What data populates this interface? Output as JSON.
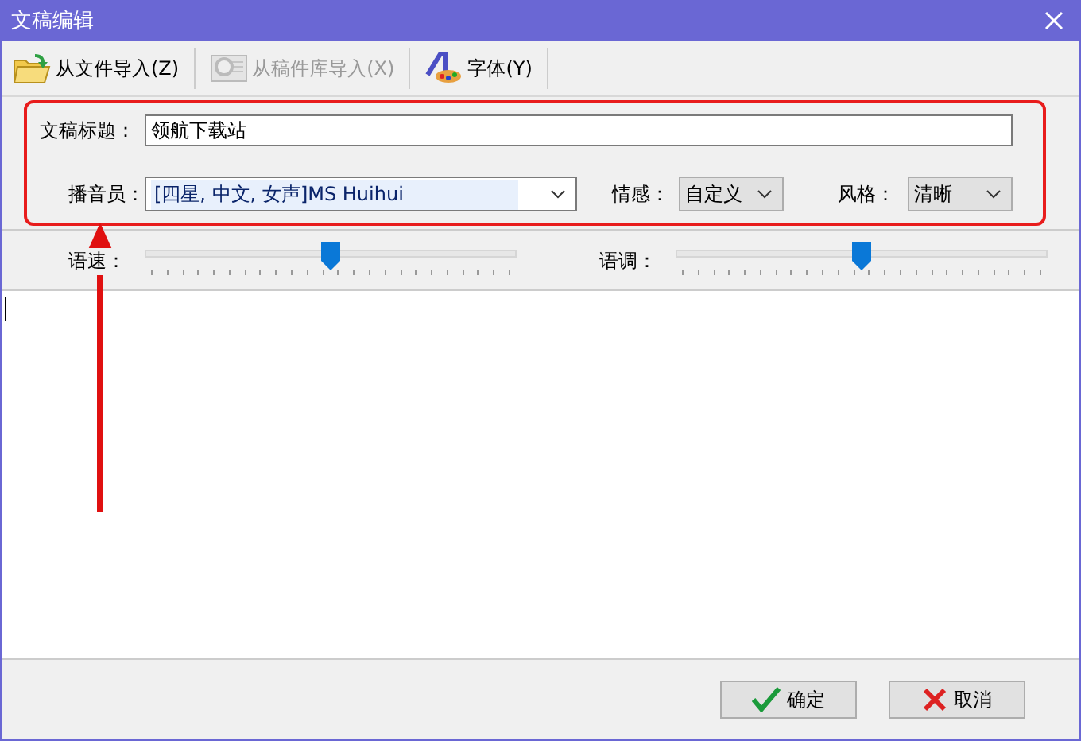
{
  "window": {
    "title": "文稿编辑"
  },
  "toolbar": [
    {
      "kind": "folder",
      "label": "从文件导入(Z)",
      "disabled": false
    },
    {
      "kind": "library",
      "label": "从稿件库导入(X)",
      "disabled": true
    },
    {
      "kind": "font",
      "label": "字体(Y)",
      "disabled": false
    }
  ],
  "form": {
    "title_label": "文稿标题：",
    "title_value": "领航下载站",
    "speaker_label": "播音员：",
    "speaker_value": "[四星, 中文, 女声]MS Huihui",
    "emotion_label": "情感：",
    "emotion_value": "自定义",
    "style_label": "风格：",
    "style_value": "清晰"
  },
  "sliders": [
    {
      "label": "语速：",
      "level": 0.5
    },
    {
      "label": "语调：",
      "level": 0.5
    }
  ],
  "buttons": [
    {
      "kind": "ok",
      "label": "确定"
    },
    {
      "kind": "cancel",
      "label": "取消"
    }
  ]
}
